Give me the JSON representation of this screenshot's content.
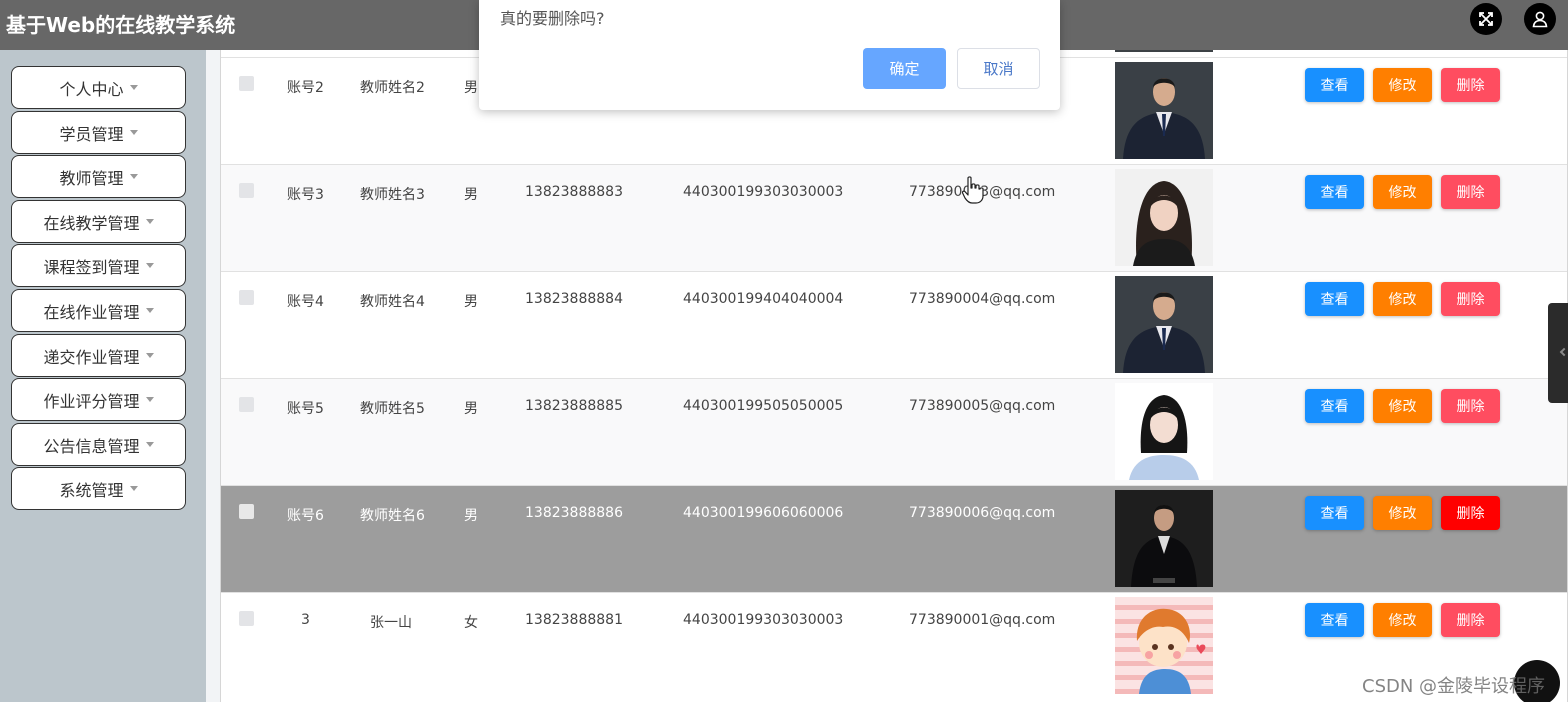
{
  "header": {
    "title": "基于Web的在线教学系统"
  },
  "sidebar": {
    "items": [
      {
        "label": "个人中心"
      },
      {
        "label": "学员管理"
      },
      {
        "label": "教师管理"
      },
      {
        "label": "在线教学管理"
      },
      {
        "label": "课程签到管理"
      },
      {
        "label": "在线作业管理"
      },
      {
        "label": "递交作业管理"
      },
      {
        "label": "作业评分管理"
      },
      {
        "label": "公告信息管理"
      },
      {
        "label": "系统管理"
      }
    ]
  },
  "table": {
    "rows": [
      {
        "account": "账号2",
        "name": "教师姓名2",
        "gender": "男",
        "phone": "",
        "id_card": "",
        "email": ""
      },
      {
        "account": "账号3",
        "name": "教师姓名3",
        "gender": "男",
        "phone": "13823888883",
        "id_card": "440300199303030003",
        "email": "773890003@qq.com"
      },
      {
        "account": "账号4",
        "name": "教师姓名4",
        "gender": "男",
        "phone": "13823888884",
        "id_card": "440300199404040004",
        "email": "773890004@qq.com"
      },
      {
        "account": "账号5",
        "name": "教师姓名5",
        "gender": "男",
        "phone": "13823888885",
        "id_card": "440300199505050005",
        "email": "773890005@qq.com"
      },
      {
        "account": "账号6",
        "name": "教师姓名6",
        "gender": "男",
        "phone": "13823888886",
        "id_card": "440300199606060006",
        "email": "773890006@qq.com"
      },
      {
        "account": "3",
        "name": "张一山",
        "gender": "女",
        "phone": "13823888881",
        "id_card": "440300199303030003",
        "email": "773890001@qq.com"
      }
    ],
    "actions": {
      "view": "查看",
      "edit": "修改",
      "delete": "删除"
    }
  },
  "dialog": {
    "message": "真的要删除吗?",
    "confirm": "确定",
    "cancel": "取消"
  },
  "watermark": "CSDN @金陵毕设程序",
  "colors": {
    "header": "#676767",
    "view": "#1890ff",
    "edit": "#ff7f00",
    "delete": "#ff4d60",
    "highlight_row": "#9d9d9d"
  }
}
